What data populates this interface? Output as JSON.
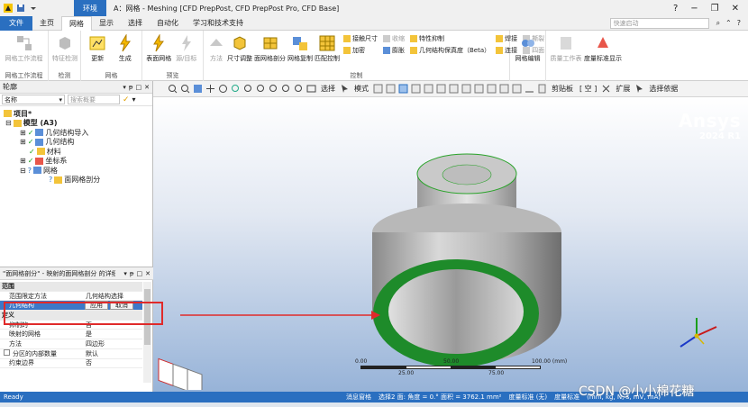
{
  "titlebar": {
    "context_tab": "环境",
    "title": "A：网格 - Meshing [CFD PrepPost, CFD PrepPost Pro, CFD Base]",
    "window_buttons": [
      "?",
      "−",
      "❐",
      "✕"
    ]
  },
  "ribbon_tabs": {
    "file": "文件",
    "tabs": [
      "主页",
      "网格",
      "显示",
      "选择",
      "自动化",
      "学习和技术支持"
    ],
    "active": "网格",
    "quick_search_placeholder": "快速启动"
  },
  "ribbon": {
    "groups": [
      {
        "label": "网格工作流程",
        "buttons": [
          "网格工作流程"
        ]
      },
      {
        "label": "检测",
        "buttons": [
          "特征检测"
        ]
      },
      {
        "label": "网格",
        "buttons": [
          "更新",
          "生成"
        ]
      },
      {
        "label": "预览",
        "buttons": [
          "表面网格",
          "源/目标"
        ]
      },
      {
        "label": "控制",
        "big": [
          "方法",
          "尺寸调整",
          "面网格剖分",
          "网格复制",
          "匹配控制"
        ],
        "small": [
          [
            "接触尺寸",
            "收缩",
            "加密",
            "膨胀"
          ],
          [
            "特性抑制",
            "几何结构保真度（Beta）"
          ],
          [
            "焊接",
            "连接",
            "撕裂",
            "四面"
          ]
        ]
      },
      {
        "label": "",
        "buttons": [
          "网格编辑"
        ]
      },
      {
        "label": "",
        "buttons": [
          "质量工作表",
          "度量标准显示"
        ]
      }
    ]
  },
  "toolbar": {
    "select_label": "选择",
    "mode_label": "模式",
    "clip_label": "剪贴板",
    "empty_label": "[ 空 ]",
    "expand_label": "扩展",
    "select_by_label": "选择依据"
  },
  "outline": {
    "header": "轮廓",
    "filter_name": "名称",
    "filter_search_placeholder": "搜索概要",
    "tree": [
      {
        "label": "项目*",
        "depth": 0
      },
      {
        "label": "模型 (A3)",
        "depth": 1
      },
      {
        "label": "几何结构导入",
        "depth": 2
      },
      {
        "label": "几何结构",
        "depth": 2
      },
      {
        "label": "材料",
        "depth": 2
      },
      {
        "label": "坐标系",
        "depth": 2
      },
      {
        "label": "网格",
        "depth": 2
      },
      {
        "label": "面网格剖分",
        "depth": 3
      }
    ]
  },
  "details": {
    "header": "\"面网格剖分\" - 映射的面网格剖分 的详细信息",
    "rows": [
      {
        "k": "范围",
        "v": "",
        "cat": true
      },
      {
        "k": "范围限定方法",
        "v": "几何结构选择"
      },
      {
        "k": "几何结构",
        "v": "",
        "sel": true
      },
      {
        "k": "定义",
        "v": "",
        "cat": true
      },
      {
        "k": "抑制的",
        "v": "否"
      },
      {
        "k": "映射的网格",
        "v": "是"
      },
      {
        "k": "方法",
        "v": "四边形"
      },
      {
        "k": "分区的内部数量",
        "v": "默认"
      },
      {
        "k": "约束边界",
        "v": "否"
      }
    ],
    "apply_label": "应用",
    "cancel_label": "取消"
  },
  "viewport": {
    "brand": "Ansys",
    "version": "2024 R1",
    "scale_top": [
      "0.00",
      "50.00",
      "100.00 (mm)"
    ],
    "scale_bottom": [
      "25.00",
      "75.00"
    ]
  },
  "statusbar": {
    "ready": "Ready",
    "items": [
      "消息窗格",
      "选择2 面: 角度 = 0.° 面积 = 3762.1 mm²",
      "度量标准 (无)",
      "度量标准",
      "(mm, kg, N, s, mV, mA)",
      "度",
      "rad/s",
      "摄氏度"
    ]
  },
  "watermark": "CSDN @小小棉花糖"
}
